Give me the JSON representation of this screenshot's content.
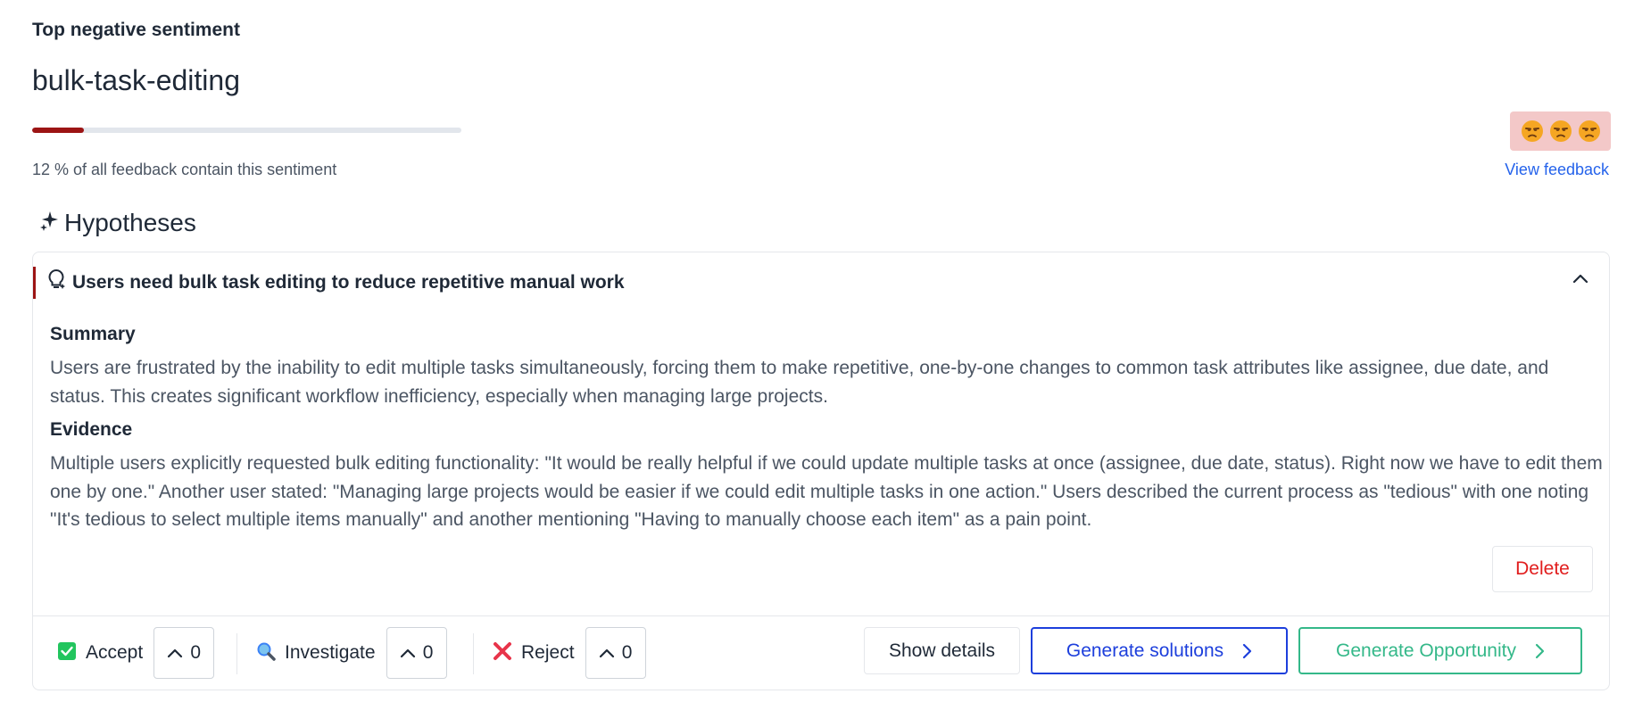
{
  "header": {
    "section_label": "Top negative sentiment",
    "topic_title": "bulk-task-editing",
    "percentage": 12,
    "percentage_text": "12 % of all feedback contain this sentiment",
    "view_feedback_label": "View feedback",
    "sentiment_emojis": [
      "unamused-face-icon",
      "unamused-face-icon",
      "unamused-face-icon"
    ]
  },
  "hypotheses": {
    "heading": "Hypotheses",
    "items": [
      {
        "title": "Users need bulk task editing to reduce repetitive manual work",
        "summary_heading": "Summary",
        "summary_text": "Users are frustrated by the inability to edit multiple tasks simultaneously, forcing them to make repetitive, one-by-one changes to common task attributes like assignee, due date, and status. This creates significant workflow inefficiency, especially when managing large projects.",
        "evidence_heading": "Evidence",
        "evidence_text": "Multiple users explicitly requested bulk editing functionality: \"It would be really helpful if we could update multiple tasks at once (assignee, due date, status). Right now we have to edit them one by one.\" Another user stated: \"Managing large projects would be easier if we could edit multiple tasks in one action.\" Users described the current process as \"tedious\" with one noting \"It's tedious to select multiple items manually\" and another mentioning \"Having to manually choose each item\" as a pain point.",
        "delete_label": "Delete",
        "votes": [
          {
            "label": "Accept",
            "icon": "check-box-icon",
            "count": "0"
          },
          {
            "label": "Investigate",
            "icon": "magnifier-icon",
            "count": "0"
          },
          {
            "label": "Reject",
            "icon": "cross-mark-icon",
            "count": "0"
          }
        ],
        "actions": {
          "show_details": "Show details",
          "generate_solutions": "Generate solutions",
          "generate_opportunity": "Generate Opportunity"
        }
      }
    ]
  },
  "colors": {
    "negative_accent": "#9c1414",
    "link_blue": "#2563eb",
    "solutions_blue": "#1d3fdc",
    "opportunity_green": "#34b889",
    "delete_red": "#e11d1d",
    "emoji_badge_bg": "#f3c8c8"
  }
}
